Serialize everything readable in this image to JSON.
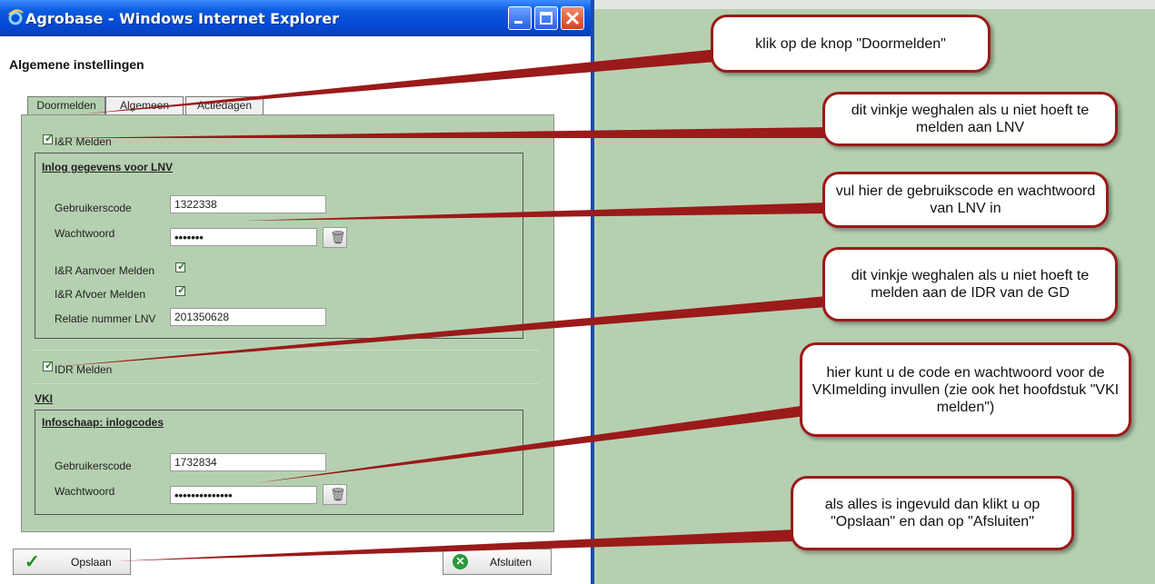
{
  "window": {
    "title": "Agrobase - Windows Internet Explorer"
  },
  "page": {
    "title": "Algemene instellingen"
  },
  "tabs": [
    {
      "label": "Doormelden",
      "active": true
    },
    {
      "label": "Algemeen",
      "active": false
    },
    {
      "label": "Actiedagen",
      "active": false
    }
  ],
  "ir": {
    "checkbox_label": "I&R Melden",
    "checked": true,
    "group_title": "Inlog gegevens voor LNV",
    "user_label": "Gebruikerscode",
    "user_value": "1322338",
    "password_label": "Wachtwoord",
    "password_value": "•••••••",
    "aanvoer_label": "I&R Aanvoer Melden",
    "aanvoer_checked": true,
    "afvoer_label": "I&R Afvoer Melden",
    "afvoer_checked": true,
    "relatie_label": "Relatie nummer LNV",
    "relatie_value": "201350628"
  },
  "idr": {
    "checkbox_label": "IDR Melden",
    "checked": true
  },
  "vki": {
    "heading": "VKI",
    "group_title": "Infoschaap: inlogcodes",
    "user_label": "Gebruikerscode",
    "user_value": "1732834",
    "password_label": "Wachtwoord",
    "password_value": "••••••••••••••"
  },
  "buttons": {
    "save": "Opslaan",
    "close": "Afsluiten"
  },
  "callouts": [
    "klik op de knop \"Doormelden\"",
    "dit vinkje weghalen als u niet hoeft te melden aan LNV",
    "vul hier de gebruikscode en wachtwoord van LNV in",
    "dit vinkje weghalen als u niet hoeft te melden aan de IDR van de GD",
    "hier kunt u de code en wachtwoord voor de VKImelding invullen (zie ook het hoofdstuk \"VKI melden\")",
    "als alles is ingevuld dan klikt u op \"Opslaan\" en dan op \"Afsluiten\""
  ],
  "colors": {
    "panel": "#b5d0b0",
    "callout_border": "#9b1a1a",
    "titlebar": "#0549d4"
  }
}
